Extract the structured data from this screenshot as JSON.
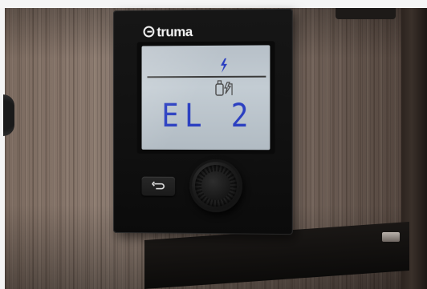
{
  "brand": {
    "name": "truma"
  },
  "display": {
    "top_icon": "electric-lightning-icon",
    "status_icon": "gas-bottle-electric-icon",
    "value": "EL 2"
  },
  "controls": {
    "back_button_icon": "return-arrow-icon",
    "rotary_knob": "rotary-push-knob"
  },
  "colors": {
    "lcd_background": "#bcc5cc",
    "lcd_segment": "#2b3fc1",
    "panel": "#121212",
    "wood": "#7f6e63"
  }
}
